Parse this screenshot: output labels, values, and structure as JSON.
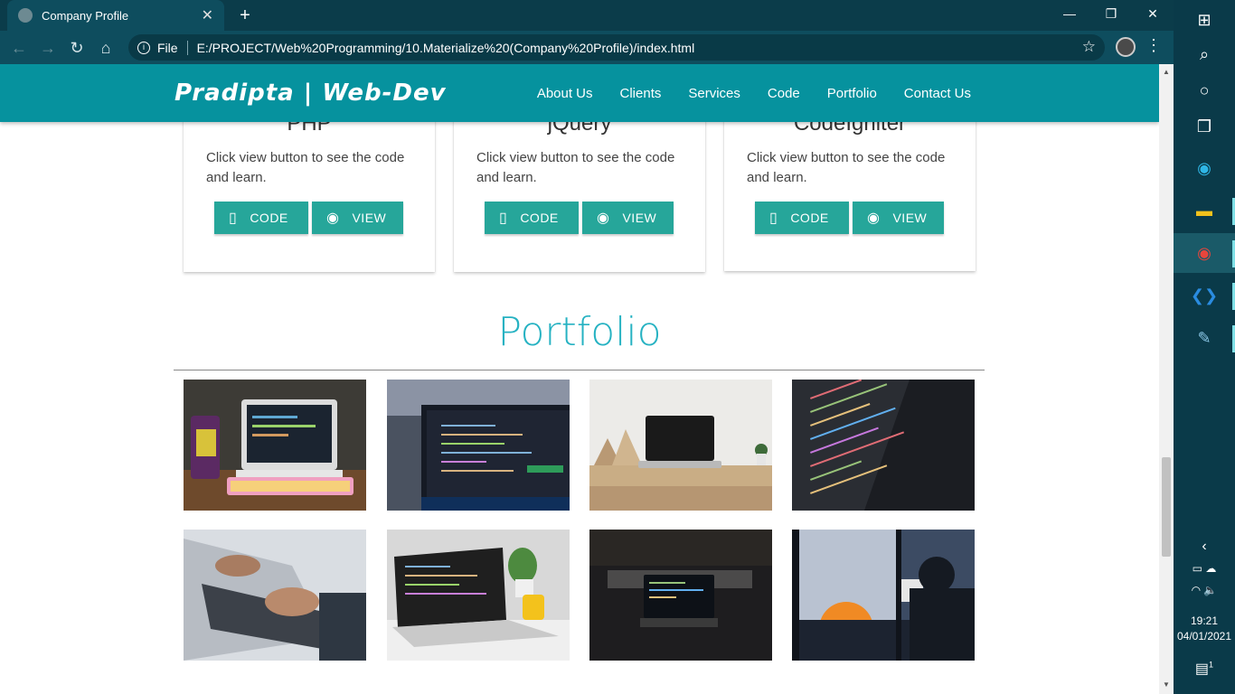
{
  "browser": {
    "tab_title": "Company Profile",
    "tab_close": "✕",
    "new_tab": "+",
    "scheme_label": "File",
    "url": "E:/PROJECT/Web%20Programming/10.Materialize%20(Company%20Profile)/index.html",
    "window_controls": [
      "—",
      "❐",
      "✕"
    ]
  },
  "site": {
    "brand": "Pradipta | Web-Dev",
    "menu": [
      "About Us",
      "Clients",
      "Services",
      "Code",
      "Portfolio",
      "Contact Us"
    ],
    "accent_color": "#06929e",
    "button_color": "#26a69a"
  },
  "cards": [
    {
      "title": "PHP",
      "text": "Click view button to see the code and learn.",
      "code_label": "CODE",
      "view_label": "VIEW"
    },
    {
      "title": "jQuery",
      "text": "Click view button to see the code and learn.",
      "code_label": "CODE",
      "view_label": "VIEW"
    },
    {
      "title": "CodeIgniter",
      "text": "Click view button to see the code and learn.",
      "code_label": "CODE",
      "view_label": "VIEW"
    }
  ],
  "portfolio": {
    "title": "Portfolio",
    "photos": [
      "laptop-with-colorful-keyboard",
      "laptop-with-code-editor",
      "laptop-on-desk",
      "code-on-monitor",
      "hands-typing-laptop",
      "laptop-with-plant-and-mug",
      "laptop-in-dark-room",
      "person-at-sunset-window"
    ]
  },
  "taskbar": {
    "time": "19:21",
    "date": "04/01/2021",
    "notifications": "1"
  }
}
